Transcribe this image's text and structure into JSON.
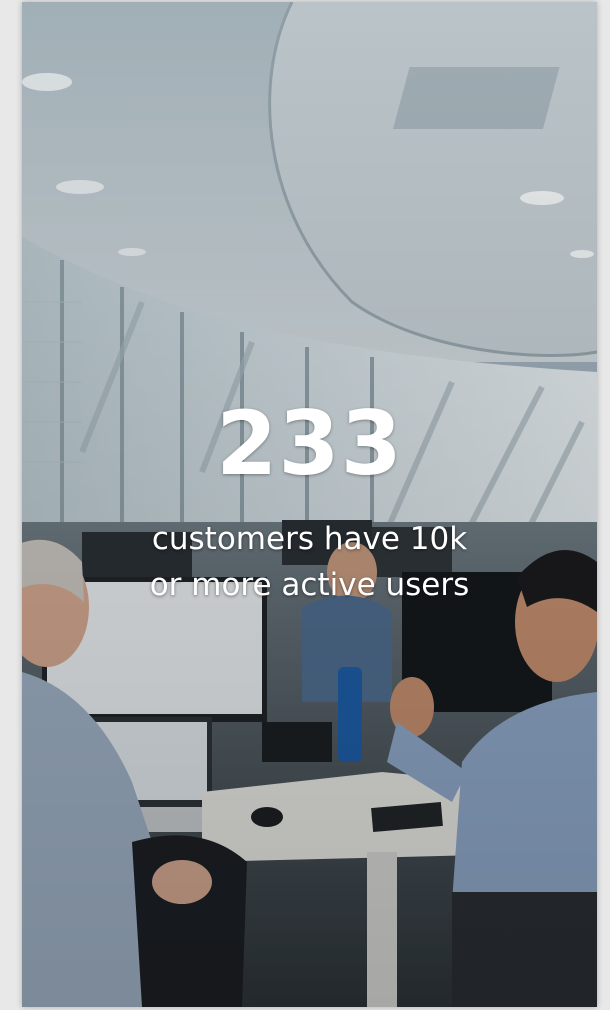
{
  "stat": {
    "number": "233",
    "caption_line1": "customers have 10k",
    "caption_line2": "or more active users"
  },
  "colors": {
    "text": "#ffffff",
    "ceiling": "#c9d3d8",
    "window": "#dfe6ea",
    "desk": "#e9e9e6"
  },
  "image": {
    "subject": "office-team-photo"
  }
}
